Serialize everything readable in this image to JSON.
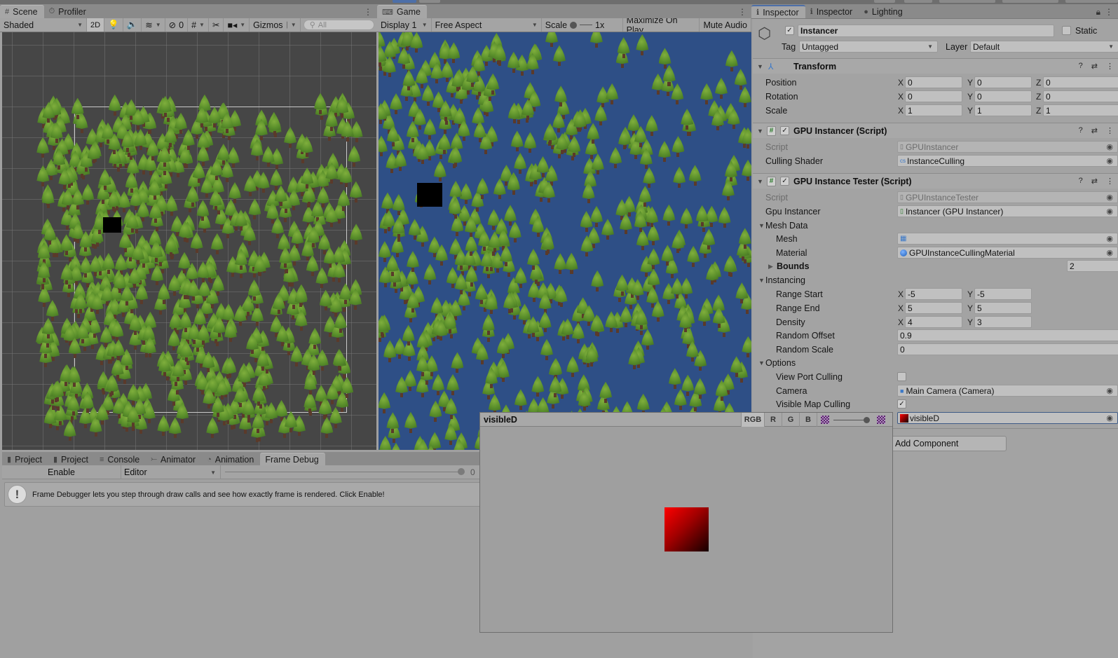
{
  "scene_panel": {
    "tabs": [
      {
        "label": "Scene",
        "icon": "grid-icon",
        "active": true
      },
      {
        "label": "Profiler",
        "icon": "stopwatch-icon",
        "active": false
      }
    ],
    "toolbar": {
      "draw_mode": "Shaded",
      "mode_2d": "2D",
      "hidden_count": "0",
      "gizmos_label": "Gizmos",
      "search_placeholder": "All"
    }
  },
  "game_panel": {
    "tabs": [
      {
        "label": "Game",
        "icon": "gamepad-icon",
        "active": true
      }
    ],
    "toolbar": {
      "display": "Display 1",
      "aspect": "Free Aspect",
      "scale_label": "Scale",
      "scale_value": "1x",
      "maximize_on_play": "Maximize On Play",
      "mute_audio": "Mute Audio"
    }
  },
  "inspector": {
    "tabs": [
      {
        "label": "Inspector",
        "icon": "info-icon",
        "active": true
      },
      {
        "label": "Inspector",
        "icon": "info-icon",
        "active": false
      },
      {
        "label": "Lighting",
        "icon": "bulb-icon",
        "active": false
      }
    ],
    "object": {
      "active": true,
      "name": "Instancer",
      "static_label": "Static",
      "static": false,
      "tag_label": "Tag",
      "tag": "Untagged",
      "layer_label": "Layer",
      "layer": "Default"
    },
    "transform": {
      "title": "Transform",
      "rows": [
        {
          "label": "Position",
          "x": "0",
          "y": "0",
          "z": "0"
        },
        {
          "label": "Rotation",
          "x": "0",
          "y": "0",
          "z": "0"
        },
        {
          "label": "Scale",
          "x": "1",
          "y": "1",
          "z": "1"
        }
      ]
    },
    "gpu_instancer": {
      "title": "GPU Instancer (Script)",
      "enabled": true,
      "script_label": "Script",
      "script": "GPUInstancer",
      "culling_shader_label": "Culling Shader",
      "culling_shader": "InstanceCulling"
    },
    "gpu_tester": {
      "title": "GPU Instance Tester (Script)",
      "enabled": true,
      "script_label": "Script",
      "script": "GPUInstanceTester",
      "gpu_instancer_label": "Gpu Instancer",
      "gpu_instancer": "Instancer (GPU Instancer)",
      "mesh_data_label": "Mesh Data",
      "mesh_label": "Mesh",
      "mesh": "",
      "material_label": "Material",
      "material": "GPUInstanceCullingMaterial",
      "bounds_label": "Bounds",
      "bounds_value": "2",
      "instancing_label": "Instancing",
      "range_start_label": "Range Start",
      "range_start": {
        "x": "-5",
        "y": "-5"
      },
      "range_end_label": "Range End",
      "range_end": {
        "x": "5",
        "y": "5"
      },
      "density_label": "Density",
      "density": {
        "x": "4",
        "y": "3"
      },
      "random_offset_label": "Random Offset",
      "random_offset": "0.9",
      "random_scale_label": "Random Scale",
      "random_scale": "0",
      "options_label": "Options",
      "view_port_culling_label": "View Port Culling",
      "view_port_culling": false,
      "camera_label": "Camera",
      "camera": "Main Camera (Camera)",
      "visible_map_culling_label": "Visible Map Culling",
      "visible_map_culling": true,
      "visible_map": "visibleD"
    },
    "add_component": "Add Component"
  },
  "bottom_panel": {
    "tabs": [
      {
        "label": "Project",
        "icon": "folder-icon",
        "active": false
      },
      {
        "label": "Project",
        "icon": "folder-icon",
        "active": false
      },
      {
        "label": "Console",
        "icon": "console-icon",
        "active": false
      },
      {
        "label": "Animator",
        "icon": "animator-icon",
        "active": false
      },
      {
        "label": "Animation",
        "icon": "animation-icon",
        "active": false
      },
      {
        "label": "Frame Debug",
        "icon": "",
        "active": true
      }
    ],
    "enable_button": "Enable",
    "target": "Editor",
    "slider_value": "0",
    "help_text": "Frame Debugger lets you step through draw calls and see how exactly frame is rendered. Click Enable!"
  },
  "texture_preview": {
    "title": "visibleD",
    "channels": [
      "RGB",
      "R",
      "G",
      "B"
    ],
    "selected_channel": "RGB",
    "mip_level": 1.0,
    "colors": {
      "tex_start": "#ff0000",
      "tex_end": "#150000"
    }
  }
}
